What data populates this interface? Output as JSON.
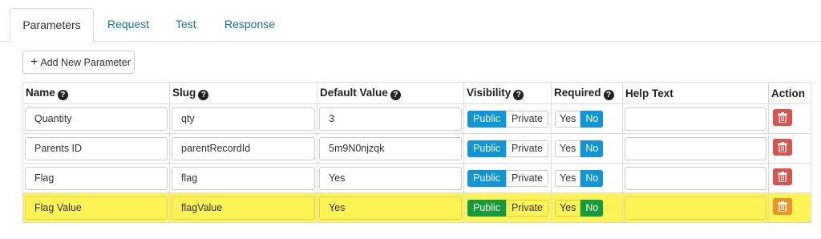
{
  "tabs": {
    "parameters": "Parameters",
    "request": "Request",
    "test": "Test",
    "response": "Response"
  },
  "add_button": {
    "icon": "+",
    "label": "Add New Parameter"
  },
  "table": {
    "headers": {
      "name": "Name",
      "slug": "Slug",
      "default": "Default Value",
      "visibility": "Visibility",
      "required": "Required",
      "help": "Help Text",
      "action": "Action"
    },
    "rows": [
      {
        "name": "Quantity",
        "slug": "qty",
        "default": "3",
        "public": "Public",
        "private": "Private",
        "yes": "Yes",
        "no": "No",
        "help": ""
      },
      {
        "name": "Parents ID",
        "slug": "parentRecordId",
        "default": "5m9N0njzqk",
        "public": "Public",
        "private": "Private",
        "yes": "Yes",
        "no": "No",
        "help": ""
      },
      {
        "name": "Flag",
        "slug": "flag",
        "default": "Yes",
        "public": "Public",
        "private": "Private",
        "yes": "Yes",
        "no": "No",
        "help": ""
      },
      {
        "name": "Flag Value",
        "slug": "flagValue",
        "default": "Yes",
        "public": "Public",
        "private": "Private",
        "yes": "Yes",
        "no": "No",
        "help": ""
      }
    ]
  },
  "colors": {
    "link": "#1a73a8",
    "toggle_active": "#0f96d8",
    "toggle_active_highlight": "#149b3a",
    "highlight_row": "#fef355",
    "delete": "#d9534f",
    "delete_highlight": "#f0932b"
  }
}
